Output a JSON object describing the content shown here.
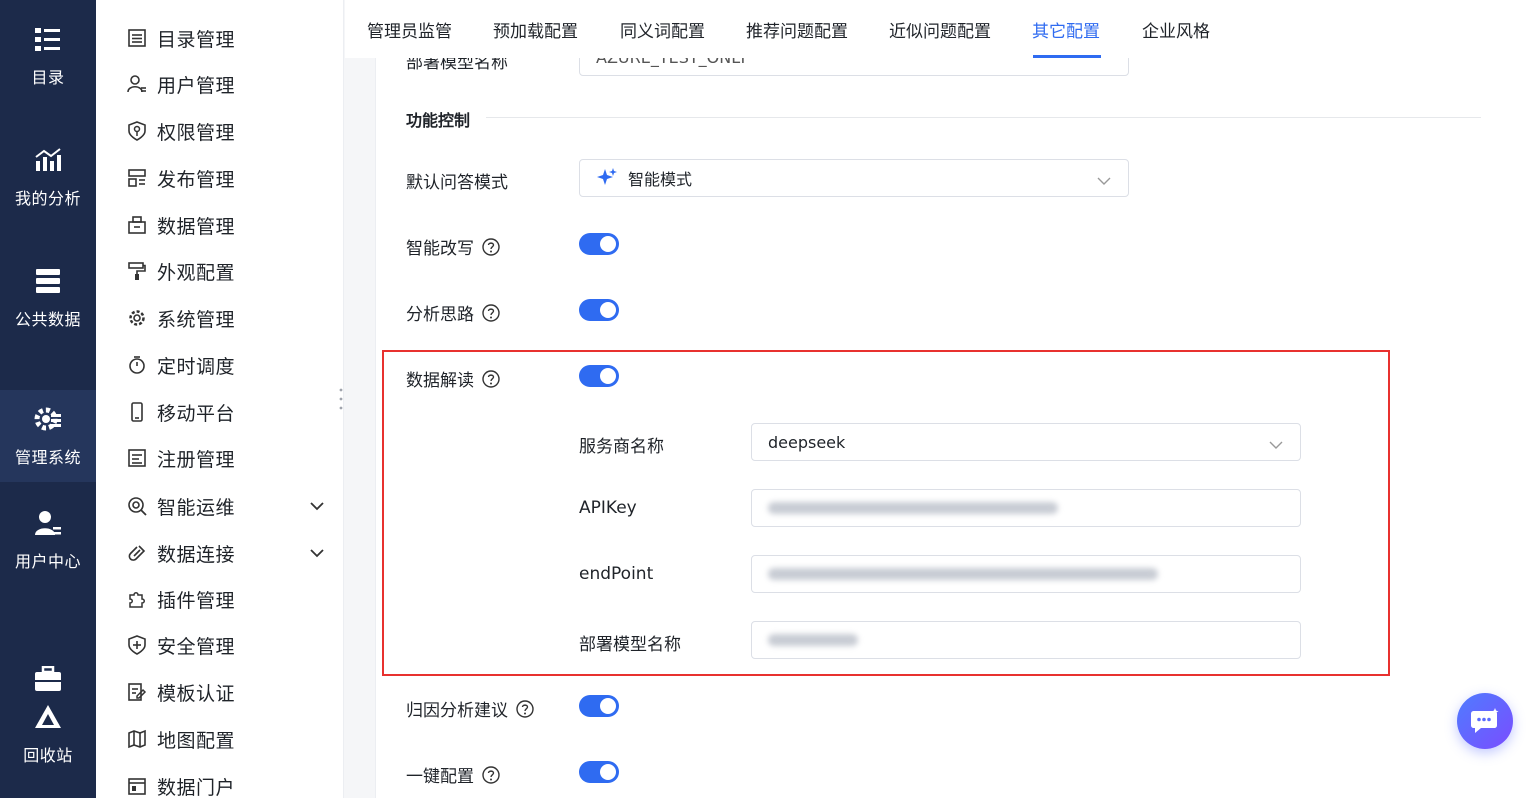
{
  "rail": {
    "items": [
      {
        "label": "目录",
        "icon": "catalog-icon"
      },
      {
        "label": "我的分析",
        "icon": "analysis-icon"
      },
      {
        "label": "公共数据",
        "icon": "public-data-icon"
      },
      {
        "label": "管理系统",
        "icon": "gear-settings-icon",
        "active": true
      },
      {
        "label": "用户中心",
        "icon": "user-center-icon"
      },
      {
        "label": "回收站",
        "icon": "recycle-bin-icon"
      }
    ]
  },
  "menu": {
    "items": [
      {
        "label": "目录管理",
        "icon": "list-icon"
      },
      {
        "label": "用户管理",
        "icon": "user-icon"
      },
      {
        "label": "权限管理",
        "icon": "shield-key-icon"
      },
      {
        "label": "发布管理",
        "icon": "publish-icon"
      },
      {
        "label": "数据管理",
        "icon": "data-box-icon"
      },
      {
        "label": "外观配置",
        "icon": "paint-roller-icon"
      },
      {
        "label": "系统管理",
        "icon": "gear-icon"
      },
      {
        "label": "定时调度",
        "icon": "stopwatch-icon"
      },
      {
        "label": "移动平台",
        "icon": "mobile-icon"
      },
      {
        "label": "注册管理",
        "icon": "register-icon"
      },
      {
        "label": "智能运维",
        "icon": "ops-icon",
        "expandable": true
      },
      {
        "label": "数据连接",
        "icon": "link-icon",
        "expandable": true
      },
      {
        "label": "插件管理",
        "icon": "puzzle-icon"
      },
      {
        "label": "安全管理",
        "icon": "shield-plus-icon"
      },
      {
        "label": "模板认证",
        "icon": "template-cert-icon"
      },
      {
        "label": "地图配置",
        "icon": "map-icon"
      },
      {
        "label": "数据门户",
        "icon": "portal-icon"
      }
    ]
  },
  "tabs": [
    {
      "label": "管理员监管"
    },
    {
      "label": "预加载配置"
    },
    {
      "label": "同义词配置"
    },
    {
      "label": "推荐问题配置"
    },
    {
      "label": "近似问题配置"
    },
    {
      "label": "其它配置",
      "active": true
    },
    {
      "label": "企业风格"
    }
  ],
  "form": {
    "top_partial_label": "部署模型名称",
    "top_partial_value": "AZURE_TEST_ONLY",
    "section_title": "功能控制",
    "default_mode_label": "默认问答模式",
    "default_mode_value": "智能模式",
    "smart_rewrite_label": "智能改写",
    "analysis_thinking_label": "分析思路",
    "data_interpretation_label": "数据解读",
    "provider_label": "服务商名称",
    "provider_value": "deepseek",
    "apikey_label": "APIKey",
    "endpoint_label": "endPoint",
    "deploy_model_label": "部署模型名称",
    "attribution_label": "归因分析建议",
    "one_click_label": "一键配置"
  },
  "switches": {
    "smart_rewrite": true,
    "analysis_thinking": true,
    "data_interpretation": true,
    "attribution": true,
    "one_click": true
  },
  "colors": {
    "accent": "#2f6bf1",
    "rail_bg": "#1c2a4a",
    "highlight_border": "#e8312f"
  }
}
